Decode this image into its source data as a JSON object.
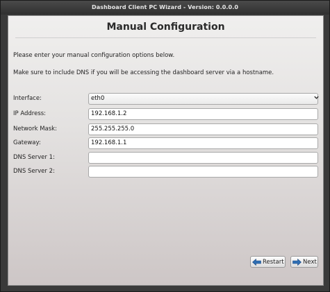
{
  "window": {
    "title": "Dashboard Client PC Wizard - Version: 0.0.0.0"
  },
  "page": {
    "heading": "Manual Configuration",
    "instructions": [
      "Please enter your manual configuration options below.",
      "Make sure to include DNS if you will be accessing the dashboard server via a hostname."
    ]
  },
  "form": {
    "interface": {
      "label": "Interface:",
      "value": "eth0",
      "options": [
        "eth0"
      ]
    },
    "ip_address": {
      "label": "IP Address:",
      "value": "192.168.1.2"
    },
    "network_mask": {
      "label": "Network Mask:",
      "value": "255.255.255.0"
    },
    "gateway": {
      "label": "Gateway:",
      "value": "192.168.1.1"
    },
    "dns1": {
      "label": "DNS Server 1:",
      "value": ""
    },
    "dns2": {
      "label": "DNS Server 2:",
      "value": ""
    }
  },
  "buttons": {
    "restart": {
      "label": "Restart",
      "icon": "arrow-left-icon"
    },
    "next": {
      "label": "Next",
      "icon": "arrow-right-icon"
    }
  },
  "colors": {
    "arrow_blue": "#2f6fb4"
  }
}
